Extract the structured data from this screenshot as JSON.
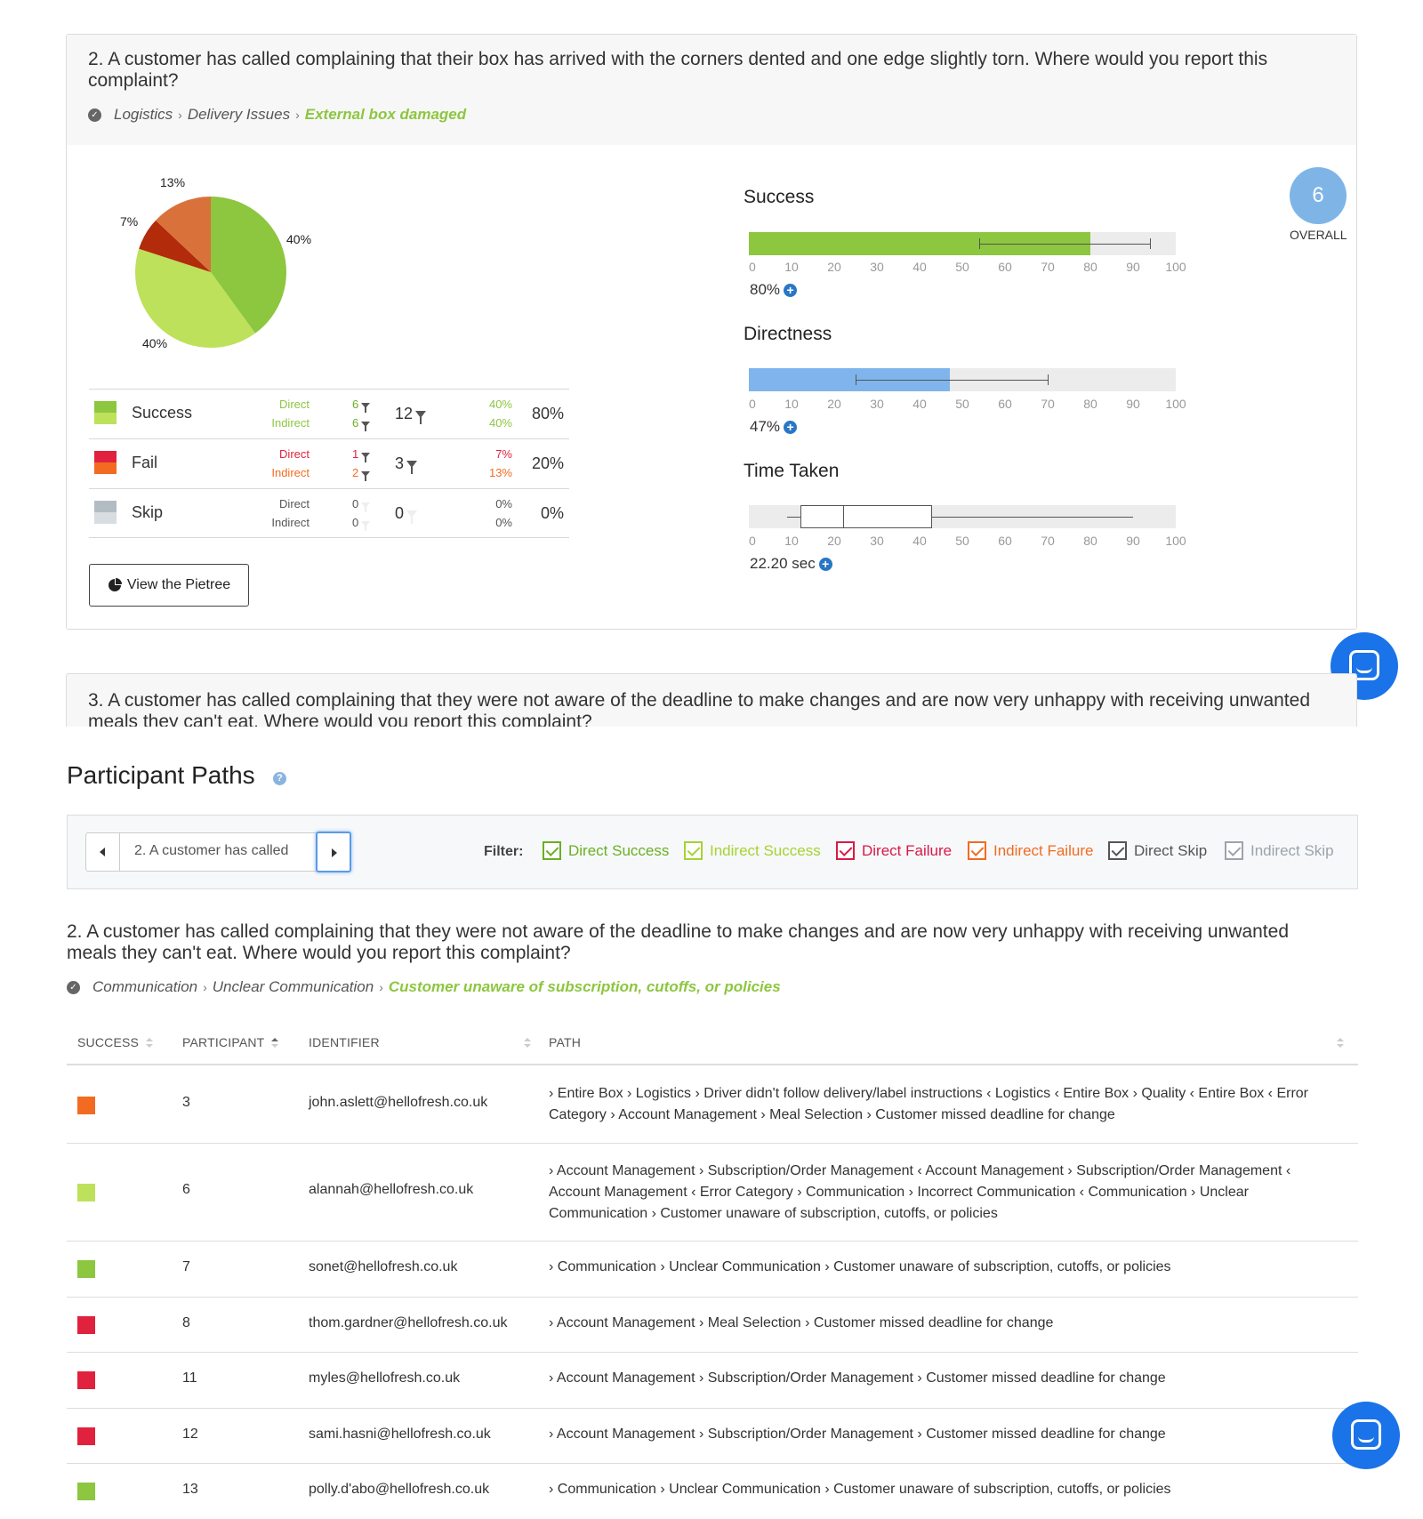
{
  "q2_card": {
    "title": "2. A customer has called complaining that their box has arrived with the corners dented and one edge slightly torn. Where would you report this complaint?",
    "breadcrumb": [
      "Logistics",
      "Delivery Issues"
    ],
    "breadcrumb_final": "External box damaged"
  },
  "pie": {
    "slices": [
      {
        "label": "40%",
        "value": 40,
        "color": "#8dc63f"
      },
      {
        "label": "40%",
        "value": 40,
        "color": "#bde15a"
      },
      {
        "label": "7%",
        "value": 7,
        "color": "#b22b0a"
      },
      {
        "label": "13%",
        "value": 13,
        "color": "#d9723a"
      }
    ]
  },
  "stats": [
    {
      "name": "Success",
      "colors": [
        "#8dc63f",
        "#bde15a"
      ],
      "sub_color": "#8dc63f",
      "sub_color2": "#8dc63f",
      "direct_label": "Direct",
      "indirect_label": "Indirect",
      "direct_count": "6",
      "indirect_count": "6",
      "total": "12",
      "direct_pct": "40%",
      "indirect_pct": "40%",
      "pct": "80%"
    },
    {
      "name": "Fail",
      "colors": [
        "#e0223f",
        "#f26b21"
      ],
      "sub_color": "#e0223f",
      "sub_color2": "#f26b21",
      "direct_label": "Direct",
      "indirect_label": "Indirect",
      "direct_count": "1",
      "indirect_count": "2",
      "total": "3",
      "direct_pct": "7%",
      "indirect_pct": "13%",
      "pct": "20%"
    },
    {
      "name": "Skip",
      "colors": [
        "#b3bcc3",
        "#d7dde1"
      ],
      "sub_color": "#555555",
      "sub_color2": "#555555",
      "direct_label": "Direct",
      "indirect_label": "Indirect",
      "direct_count": "0",
      "indirect_count": "0",
      "total": "0",
      "direct_pct": "0%",
      "indirect_pct": "0%",
      "pct": "0%"
    }
  ],
  "view_pietree_label": "View the Pietree",
  "axis_ticks": [
    "0",
    "10",
    "20",
    "30",
    "40",
    "50",
    "60",
    "70",
    "80",
    "90",
    "100"
  ],
  "metrics": {
    "success": {
      "title": "Success",
      "value_label": "80%",
      "fill": 80,
      "ci": [
        54,
        94
      ],
      "color": "#8dc63f"
    },
    "directness": {
      "title": "Directness",
      "value_label": "47%",
      "fill": 47,
      "ci": [
        25,
        70
      ],
      "color": "#7fb5ec"
    },
    "time": {
      "title": "Time Taken",
      "value_label": "22.20 sec",
      "box": [
        12,
        43
      ],
      "median": 22,
      "whisker": [
        9,
        90
      ]
    }
  },
  "overall": {
    "score": "6",
    "label": "OVERALL"
  },
  "q3_peek_title": "3. A customer has called complaining that they were not aware of the deadline to make changes and are now very unhappy with receiving unwanted meals they can't eat. Where would you report this complaint?",
  "participant_paths": {
    "title": "Participant Paths",
    "help": "?",
    "selector_label": "2. A customer has called",
    "filter_label": "Filter:",
    "filters": [
      {
        "label": "Direct Success",
        "color": "#6ab023"
      },
      {
        "label": "Indirect Success",
        "color": "#a6d331"
      },
      {
        "label": "Direct Failure",
        "color": "#d91a46"
      },
      {
        "label": "Indirect Failure",
        "color": "#f26b21"
      },
      {
        "label": "Direct Skip",
        "color": "#555555"
      },
      {
        "label": "Indirect Skip",
        "color": "#9aa4ab"
      }
    ],
    "question_title": "2. A customer has called complaining that they were not aware of the deadline to make changes and are now very unhappy with receiving unwanted meals they can't eat. Where would you report this complaint?",
    "breadcrumb": [
      "Communication",
      "Unclear Communication"
    ],
    "breadcrumb_final": "Customer unaware of subscription, cutoffs, or policies",
    "columns": [
      "SUCCESS",
      "PARTICIPANT",
      "IDENTIFIER",
      "PATH"
    ],
    "rows": [
      {
        "color": "#f26b21",
        "participant": "3",
        "identifier": "john.aslett@hellofresh.co.uk",
        "path": "› Entire Box › Logistics › Driver didn't follow delivery/label instructions ‹ Logistics ‹ Entire Box › Quality ‹ Entire Box ‹ Error Category › Account Management › Meal Selection › Customer missed deadline for change"
      },
      {
        "color": "#bde15a",
        "participant": "6",
        "identifier": "alannah@hellofresh.co.uk",
        "path": "› Account Management › Subscription/Order Management ‹ Account Management › Subscription/Order Management ‹ Account Management ‹ Error Category › Communication › Incorrect Communication ‹ Communication › Unclear Communication › Customer unaware of subscription, cutoffs, or policies"
      },
      {
        "color": "#8dc63f",
        "participant": "7",
        "identifier": "sonet@hellofresh.co.uk",
        "path": "› Communication › Unclear Communication › Customer unaware of subscription, cutoffs, or policies"
      },
      {
        "color": "#e0223f",
        "participant": "8",
        "identifier": "thom.gardner@hellofresh.co.uk",
        "path": "› Account Management › Meal Selection › Customer missed deadline for change"
      },
      {
        "color": "#e0223f",
        "participant": "11",
        "identifier": "myles@hellofresh.co.uk",
        "path": "› Account Management › Subscription/Order Management › Customer missed deadline for change"
      },
      {
        "color": "#e0223f",
        "participant": "12",
        "identifier": "sami.hasni@hellofresh.co.uk",
        "path": "› Account Management › Subscription/Order Management › Customer missed deadline for change"
      },
      {
        "color": "#8dc63f",
        "participant": "13",
        "identifier": "polly.d'abo@hellofresh.co.uk",
        "path": "› Communication › Unclear Communication › Customer unaware of subscription, cutoffs, or policies"
      }
    ]
  }
}
